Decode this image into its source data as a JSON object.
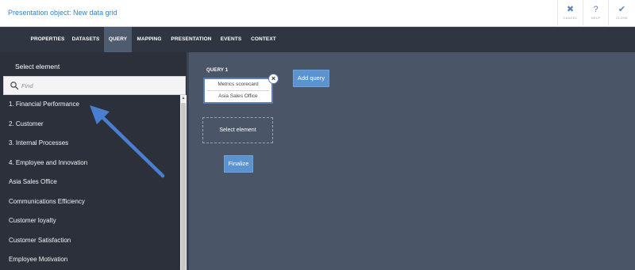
{
  "header": {
    "title": "Presentation object: New data grid",
    "buttons": [
      {
        "label": "CANCEL",
        "icon": "x-icon",
        "glyph": "✖"
      },
      {
        "label": "HELP",
        "icon": "question-icon",
        "glyph": "?"
      },
      {
        "label": "CLOSE",
        "icon": "checkmark-icon",
        "glyph": "✔"
      }
    ]
  },
  "tabs": [
    {
      "label": "PROPERTIES"
    },
    {
      "label": "DATASETS"
    },
    {
      "label": "QUERY",
      "active": true
    },
    {
      "label": "MAPPING"
    },
    {
      "label": "PRESENTATION"
    },
    {
      "label": "EVENTS"
    },
    {
      "label": "CONTEXT"
    }
  ],
  "panel": {
    "title": "Select element",
    "search_placeholder": "Find",
    "items": [
      "1. Financial Performance",
      "2. Customer",
      "3. Internal Processes",
      "4. Employee and Innovation",
      "Asia Sales Office",
      "Communications Efficiency",
      "Customer loyalty",
      "Customer Satisfaction",
      "Employee Motivation"
    ]
  },
  "query": {
    "label": "QUERY 1",
    "rows": [
      "Metrics scorecard",
      "Asia Sales Office"
    ],
    "close_glyph": "×",
    "select_element": "Select element",
    "add_query": "Add query",
    "finalize": "Finalize"
  },
  "colors": {
    "accent": "#5b93d0",
    "title_blue": "#3a83c4",
    "annotation_arrow": "#4a7fd0"
  }
}
